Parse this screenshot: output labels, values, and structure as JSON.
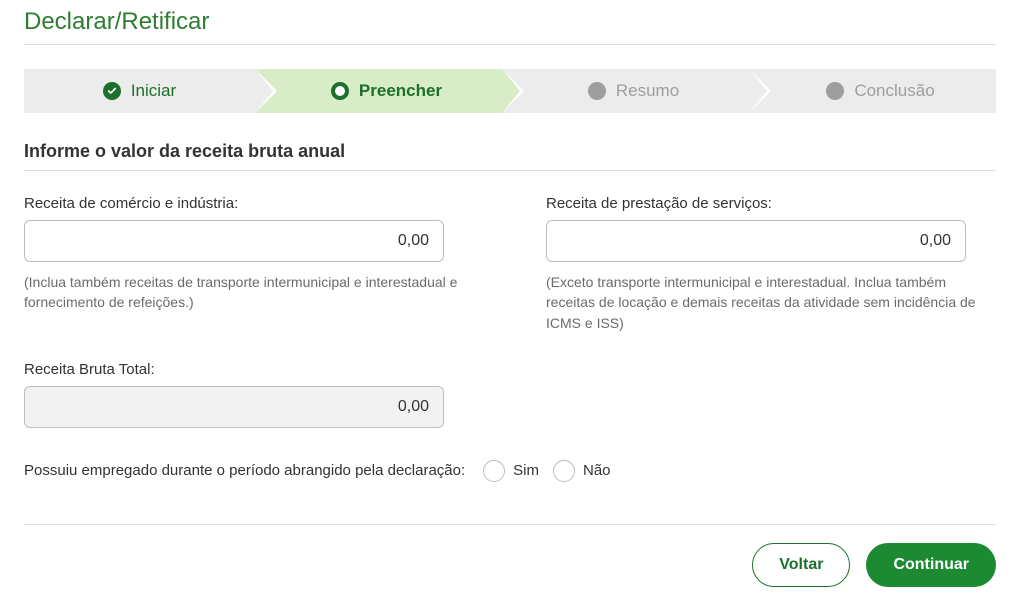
{
  "page": {
    "title": "Declarar/Retificar"
  },
  "stepper": {
    "steps": [
      {
        "label": "Iniciar",
        "state": "done"
      },
      {
        "label": "Preencher",
        "state": "active"
      },
      {
        "label": "Resumo",
        "state": "upcoming"
      },
      {
        "label": "Conclusão",
        "state": "upcoming"
      }
    ]
  },
  "section": {
    "title": "Informe o valor da receita bruta anual"
  },
  "fields": {
    "comercio": {
      "label": "Receita de comércio e indústria:",
      "value": "0,00",
      "hint": "(Inclua também receitas de transporte intermunicipal e interestadual e fornecimento de refeições.)"
    },
    "servicos": {
      "label": "Receita de prestação de serviços:",
      "value": "0,00",
      "hint": "(Exceto transporte intermunicipal e interestadual. Inclua também receitas de locação e demais receitas da atividade sem incidência de ICMS e ISS)"
    },
    "total": {
      "label": "Receita Bruta Total:",
      "value": "0,00"
    }
  },
  "question": {
    "text": "Possuiu empregado durante o período abrangido pela declaração:",
    "options": {
      "yes": "Sim",
      "no": "Não"
    }
  },
  "actions": {
    "back": "Voltar",
    "continue": "Continuar"
  }
}
